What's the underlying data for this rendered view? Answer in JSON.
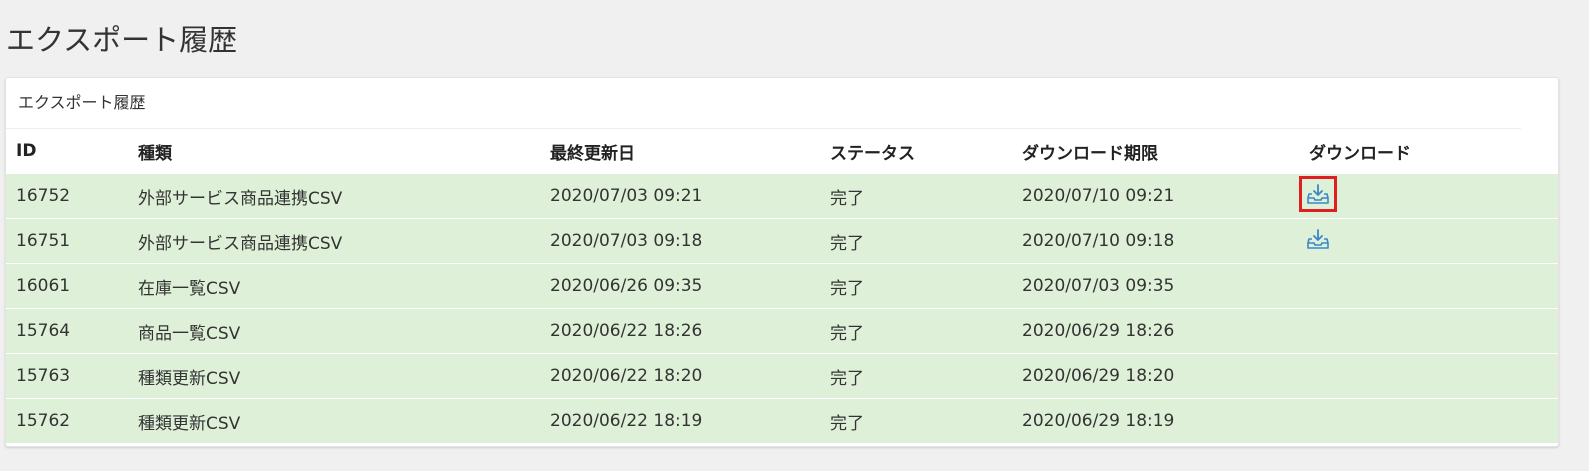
{
  "page": {
    "title": "エクスポート履歴"
  },
  "panel": {
    "heading": "エクスポート履歴"
  },
  "table": {
    "headers": {
      "id": "ID",
      "type": "種類",
      "updated": "最終更新日",
      "status": "ステータス",
      "expiry": "ダウンロード期限",
      "download": "ダウンロード"
    },
    "rows": [
      {
        "id": "16752",
        "type": "外部サービス商品連携CSV",
        "updated": "2020/07/03 09:21",
        "status": "完了",
        "expiry": "2020/07/10 09:21",
        "download": true,
        "highlighted": true
      },
      {
        "id": "16751",
        "type": "外部サービス商品連携CSV",
        "updated": "2020/07/03 09:18",
        "status": "完了",
        "expiry": "2020/07/10 09:18",
        "download": true,
        "highlighted": false
      },
      {
        "id": "16061",
        "type": "在庫一覧CSV",
        "updated": "2020/06/26 09:35",
        "status": "完了",
        "expiry": "2020/07/03 09:35",
        "download": false,
        "highlighted": false
      },
      {
        "id": "15764",
        "type": "商品一覧CSV",
        "updated": "2020/06/22 18:26",
        "status": "完了",
        "expiry": "2020/06/29 18:26",
        "download": false,
        "highlighted": false
      },
      {
        "id": "15763",
        "type": "種類更新CSV",
        "updated": "2020/06/22 18:20",
        "status": "完了",
        "expiry": "2020/06/29 18:20",
        "download": false,
        "highlighted": false
      },
      {
        "id": "15762",
        "type": "種類更新CSV",
        "updated": "2020/06/22 18:19",
        "status": "完了",
        "expiry": "2020/06/29 18:19",
        "download": false,
        "highlighted": false
      }
    ]
  },
  "colors": {
    "success_row": "#dff0d8",
    "icon": "#3a87c8",
    "highlight": "#e02020"
  },
  "icons": {
    "download": "download-tray-icon"
  }
}
